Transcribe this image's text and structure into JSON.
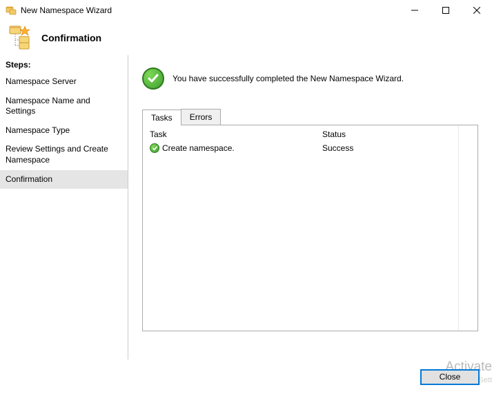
{
  "window": {
    "title": "New Namespace Wizard"
  },
  "header": {
    "title": "Confirmation"
  },
  "sidebar": {
    "steps_label": "Steps:",
    "items": [
      {
        "label": "Namespace Server"
      },
      {
        "label": "Namespace Name and Settings"
      },
      {
        "label": "Namespace Type"
      },
      {
        "label": "Review Settings and Create Namespace"
      },
      {
        "label": "Confirmation"
      }
    ],
    "active_index": 4
  },
  "main": {
    "success_message": "You have successfully completed the New Namespace Wizard.",
    "tabs": [
      {
        "label": "Tasks"
      },
      {
        "label": "Errors"
      }
    ],
    "active_tab": 0,
    "columns": {
      "task": "Task",
      "status": "Status"
    },
    "rows": [
      {
        "task": "Create namespace.",
        "status": "Success"
      }
    ]
  },
  "footer": {
    "close_label": "Close"
  },
  "watermark": {
    "line1": "Activate",
    "line2": "to Sett"
  }
}
